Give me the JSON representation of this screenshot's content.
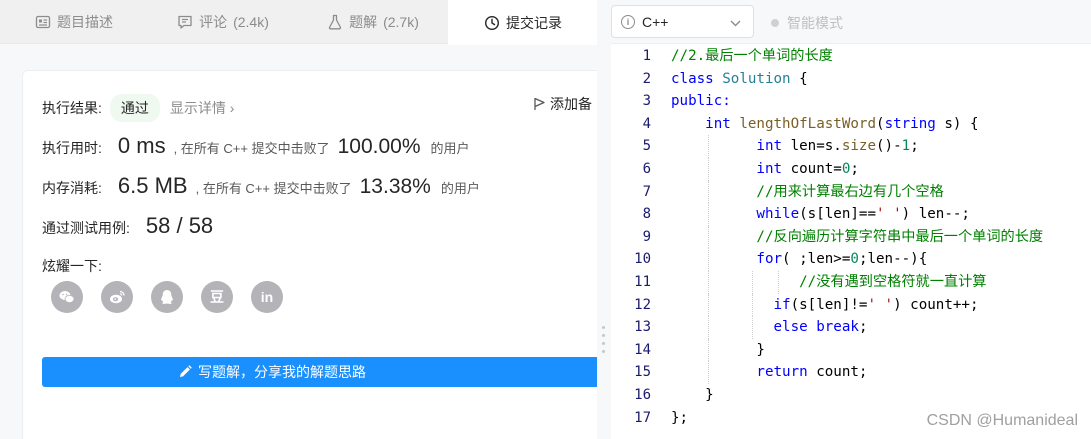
{
  "tabs": [
    {
      "label": "题目描述",
      "count": "",
      "icon": "description-icon",
      "active": false
    },
    {
      "label": "评论",
      "count": "(2.4k)",
      "icon": "comment-icon",
      "active": false
    },
    {
      "label": "题解",
      "count": "(2.7k)",
      "icon": "flask-icon",
      "active": false
    },
    {
      "label": "提交记录",
      "count": "",
      "icon": "clock-icon",
      "active": true
    }
  ],
  "result": {
    "label": "执行结果:",
    "status": "通过",
    "detail_link": "显示详情",
    "add_button": "添加备"
  },
  "runtime": {
    "label": "执行用时:",
    "value": "0 ms",
    "text": ", 在所有 C++ 提交中击败了",
    "percent": "100.00%",
    "suffix": "的用户"
  },
  "memory": {
    "label": "内存消耗:",
    "value": "6.5 MB",
    "text": ", 在所有 C++ 提交中击败了",
    "percent": "13.38%",
    "suffix": "的用户"
  },
  "tests": {
    "label": "通过测试用例:",
    "value": "58 / 58"
  },
  "share": {
    "label": "炫耀一下:",
    "icons": [
      "wechat-icon",
      "weibo-icon",
      "qq-icon",
      "douban-icon",
      "linkedin-icon"
    ],
    "douban_glyph": "豆",
    "linkedin_glyph": "in"
  },
  "write_solution_button": "写题解，分享我的解题思路",
  "editor_toolbar": {
    "language": "C++",
    "smart_mode": "智能模式"
  },
  "code": {
    "line_numbers": [
      "1",
      "2",
      "3",
      "4",
      "5",
      "6",
      "7",
      "8",
      "9",
      "10",
      "11",
      "12",
      "13",
      "14",
      "15",
      "16",
      "17"
    ],
    "line1_comment": "//2.最后一个单词的长度",
    "class_kw": "class",
    "class_name": "Solution",
    "brace_open": " {",
    "public_kw": "public:",
    "int_kw": "int",
    "func_name": "lengthOfLastWord",
    "string_kw": "string",
    "func_params_rest": " s) {",
    "l5_rest": " len=s.",
    "size_fn": "size",
    "l5_tail": "()-",
    "one": "1",
    "semi": ";",
    "l6_rest": " count=",
    "zero": "0",
    "c7": "//用来计算最右边有几个空格",
    "while_kw": "while",
    "l8_mid": "(s[len]==",
    "space_char": "' '",
    "l8_tail": ") len--;",
    "c9": "//反向遍历计算字符串中最后一个单词的长度",
    "for_kw": "for",
    "l10_a": "( ;len>=",
    "l10_b": ";len--){",
    "c11": "//没有遇到空格符就一直计算",
    "if_kw": "if",
    "l12_mid": "(s[len]!=",
    "l12_tail": ") count++;",
    "else_kw": "else",
    "break_kw": "break",
    "close_brace": "}",
    "return_kw": "return",
    "return_rest": " count;",
    "class_end": "};"
  },
  "watermark": "CSDN @Humanideal"
}
